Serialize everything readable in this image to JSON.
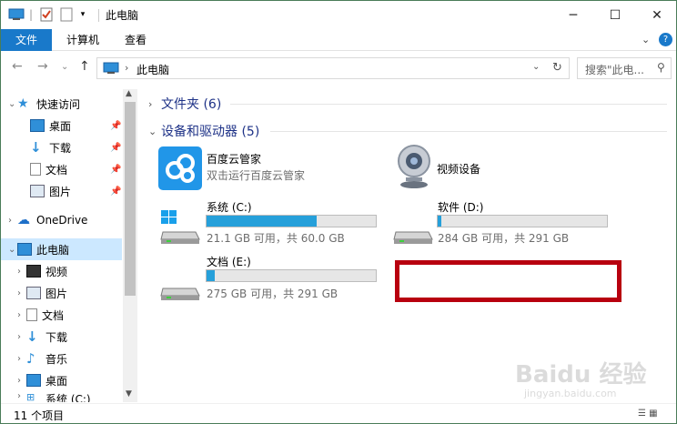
{
  "window": {
    "title": "此电脑"
  },
  "ribbon": {
    "tabs": [
      {
        "label": "文件",
        "active": true
      },
      {
        "label": "计算机",
        "active": false
      },
      {
        "label": "查看",
        "active": false
      }
    ],
    "help": "?"
  },
  "address": {
    "path": "此电脑",
    "search_placeholder": "搜索\"此电..."
  },
  "sidebar": {
    "quick_access": "快速访问",
    "quick_items": [
      "桌面",
      "下载",
      "文档",
      "图片"
    ],
    "onedrive": "OneDrive",
    "this_pc": "此电脑",
    "pc_items": [
      "视频",
      "图片",
      "文档",
      "下载",
      "音乐",
      "桌面",
      "系统 (C:)"
    ]
  },
  "main": {
    "folders_group": "文件夹 (6)",
    "devices_group": "设备和驱动器 (5)",
    "apps": [
      {
        "name": "百度云管家",
        "sub": "双击运行百度云管家"
      },
      {
        "name": "视频设备",
        "sub": ""
      }
    ],
    "drives": [
      {
        "name": "系统 (C:)",
        "space": "21.1 GB 可用，共 60.0 GB",
        "used_fraction": 0.65
      },
      {
        "name": "软件 (D:)",
        "space": "284 GB 可用，共 291 GB",
        "used_fraction": 0.02
      },
      {
        "name": "文档 (E:)",
        "space": "275 GB 可用，共 291 GB",
        "used_fraction": 0.05
      }
    ]
  },
  "status": {
    "items": "11 个项目"
  },
  "watermark": {
    "brand": "Baidu 经验",
    "url": "jingyan.baidu.com"
  },
  "colors": {
    "accent": "#1979ca",
    "bar": "#26a0da",
    "highlight": "#b8000f"
  }
}
